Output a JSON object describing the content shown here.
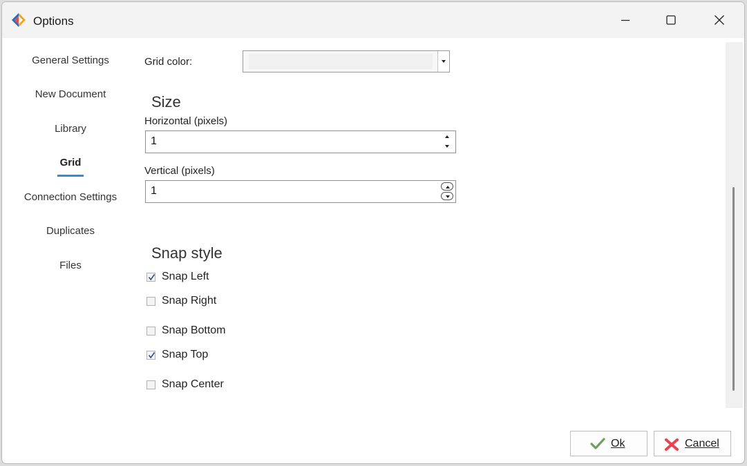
{
  "window": {
    "title": "Options"
  },
  "sidebar": {
    "items": [
      {
        "label": "General Settings",
        "active": false
      },
      {
        "label": "New Document",
        "active": false
      },
      {
        "label": "Library",
        "active": false
      },
      {
        "label": "Grid",
        "active": true
      },
      {
        "label": "Connection Settings",
        "active": false
      },
      {
        "label": "Duplicates",
        "active": false
      },
      {
        "label": "Files",
        "active": false
      }
    ],
    "accent_color": "#2b8fd6"
  },
  "grid": {
    "grid_color_label": "Grid color:",
    "size_title": "Size",
    "horizontal_label": "Horizontal (pixels)",
    "horizontal_value": "1",
    "vertical_label": "Vertical (pixels)",
    "vertical_value": "1",
    "snap_title": "Snap style",
    "snap_options": [
      {
        "label": "Snap Left",
        "checked": true
      },
      {
        "label": "Snap Right",
        "checked": false
      },
      {
        "label": "Snap Bottom",
        "checked": false
      },
      {
        "label": "Snap Top",
        "checked": true
      },
      {
        "label": "Snap Center",
        "checked": false
      }
    ]
  },
  "footer": {
    "ok_label": "Ok",
    "cancel_label": "Cancel"
  },
  "icons": {
    "app": "app-logo-icon",
    "minimize": "minimize-icon",
    "maximize": "maximize-icon",
    "close": "close-icon",
    "ok": "checkmark-icon",
    "cancel": "x-cross-icon"
  }
}
